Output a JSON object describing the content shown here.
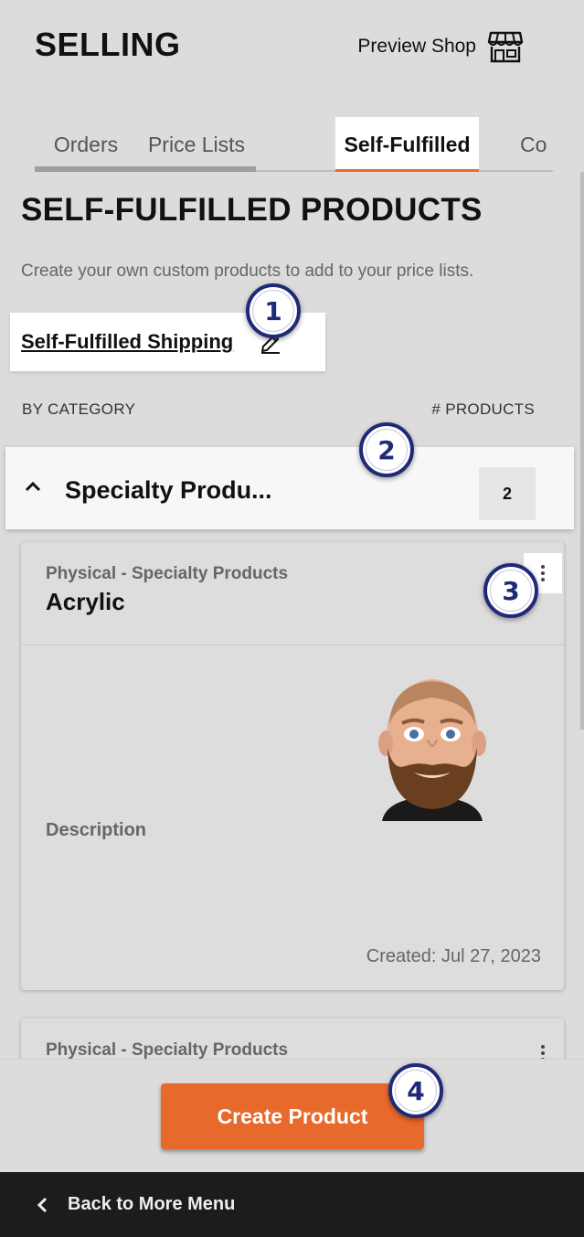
{
  "header": {
    "title": "SELLING",
    "preview_label": "Preview Shop",
    "preview_icon": "storefront-icon"
  },
  "tabs": [
    {
      "label": "Orders",
      "active": false
    },
    {
      "label": "Price Lists",
      "active": false
    },
    {
      "label": "Self-Fulfilled",
      "active": true
    },
    {
      "label": "Co",
      "active": false
    }
  ],
  "section": {
    "title": "SELF-FULFILLED PRODUCTS",
    "description": "Create your own custom products to add to your price lists.",
    "shipping_link": "Self-Fulfilled Shipping",
    "shipping_icon": "pencil-icon"
  },
  "columns": {
    "left": "BY CATEGORY",
    "right": "# PRODUCTS"
  },
  "category": {
    "label": "Specialty Produ...",
    "count": "2",
    "expanded": true
  },
  "products": [
    {
      "subtitle": "Physical - Specialty Products",
      "name": "Acrylic",
      "description_label": "Description",
      "created": "Created: Jul 27, 2023",
      "image": "avatar-image"
    },
    {
      "subtitle": "Physical - Specialty Products"
    }
  ],
  "actions": {
    "create_label": "Create Product"
  },
  "footer": {
    "back_label": "Back to More Menu"
  },
  "markers": [
    "1",
    "2",
    "3",
    "4"
  ],
  "colors": {
    "accent": "#e8692c",
    "marker": "#1e2a78",
    "footer_bg": "#1c1c1c"
  }
}
